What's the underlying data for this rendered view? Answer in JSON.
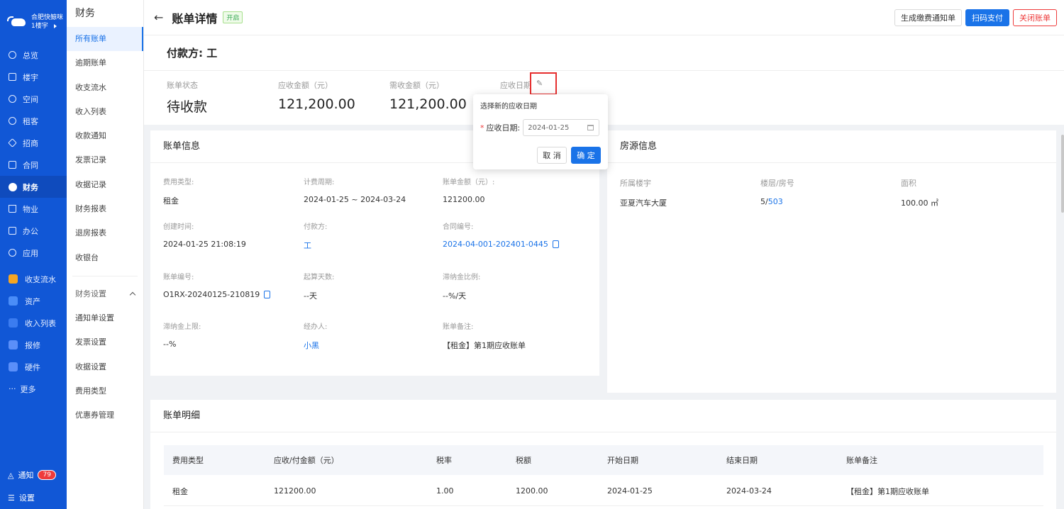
{
  "brand": {
    "name": "合肥快鲸咪",
    "building": "1楼宇"
  },
  "nav": [
    {
      "label": "总览",
      "icon": "dashboard-icon"
    },
    {
      "label": "楼宇",
      "icon": "building-icon"
    },
    {
      "label": "空间",
      "icon": "cube-icon"
    },
    {
      "label": "租客",
      "icon": "users-icon"
    },
    {
      "label": "招商",
      "icon": "tag-icon"
    },
    {
      "label": "合同",
      "icon": "contract-icon"
    },
    {
      "label": "财务",
      "icon": "finance-icon"
    },
    {
      "label": "物业",
      "icon": "home-icon"
    },
    {
      "label": "办公",
      "icon": "monitor-icon"
    },
    {
      "label": "应用",
      "icon": "app-icon"
    }
  ],
  "apps": [
    {
      "label": "收支流水",
      "color": "#f5a623"
    },
    {
      "label": "资产",
      "color": "#4a8df8"
    },
    {
      "label": "收入列表",
      "color": "#3b7cf0"
    },
    {
      "label": "报修",
      "color": "#5b8ff9"
    },
    {
      "label": "硬件",
      "color": "#5b8ff9"
    },
    {
      "label": "更多",
      "color": ""
    }
  ],
  "bottom": {
    "notify": "通知",
    "notify_count": "79",
    "settings": "设置"
  },
  "subnav": {
    "title": "财务",
    "items": [
      "所有账单",
      "逾期账单",
      "收支流水",
      "收入列表",
      "收款通知",
      "发票记录",
      "收据记录",
      "财务报表",
      "退房报表",
      "收银台"
    ],
    "group": "财务设置",
    "group_items": [
      "通知单设置",
      "发票设置",
      "收据设置",
      "费用类型",
      "优惠券管理"
    ]
  },
  "header": {
    "title": "账单详情",
    "tag": "开启",
    "btn_notice": "生成缴费通知单",
    "btn_scan": "扫码支付",
    "btn_close": "关闭账单"
  },
  "payer": "付款方: 工",
  "summary": {
    "status_label": "账单状态",
    "status_value": "待收款",
    "due_label": "应收金额（元）",
    "due_value": "121,200.00",
    "need_label": "需收金额（元）",
    "need_value": "121,200.00",
    "date_label": "应收日期"
  },
  "bill_info": {
    "title": "账单信息",
    "fee_type_label": "费用类型:",
    "fee_type": "租金",
    "period_label": "计费周期:",
    "period": "2024-01-25 ~ 2024-03-24",
    "amount_label": "账单金额（元）:",
    "amount": "121200.00",
    "created_label": "创建时间:",
    "created": "2024-01-25 21:08:19",
    "payer_label": "付款方:",
    "payer": "工",
    "contract_label": "合同编号:",
    "contract": "2024-04-001-202401-0445",
    "bill_no_label": "账单编号:",
    "bill_no": "O1RX-20240125-210819",
    "days_label": "起算天数:",
    "days": "--天",
    "late_ratio_label": "滞纳金比例:",
    "late_ratio": "--%/天",
    "late_cap_label": "滞纳金上限:",
    "late_cap": "--%",
    "handler_label": "经办人:",
    "handler": "小黑",
    "remark_label": "账单备注:",
    "remark": "【租金】第1期应收账单"
  },
  "house_info": {
    "title": "房源信息",
    "building_label": "所属楼宇",
    "building": "亚夏汽车大厦",
    "floor_label": "楼层/房号",
    "floor": "5/",
    "room": "503",
    "area_label": "面积",
    "area": "100.00 ㎡"
  },
  "detail": {
    "title": "账单明细",
    "headers": [
      "费用类型",
      "应收/付金额（元）",
      "税率",
      "税额",
      "开始日期",
      "结束日期",
      "账单备注"
    ],
    "row": [
      "租金",
      "121200.00",
      "1.00",
      "1200.00",
      "2024-01-25",
      "2024-03-24",
      "【租金】第1期应收账单"
    ]
  },
  "popover": {
    "title": "选择新的应收日期",
    "field_label": "应收日期:",
    "date_value": "2024-01-25",
    "cancel": "取 消",
    "ok": "确 定"
  }
}
